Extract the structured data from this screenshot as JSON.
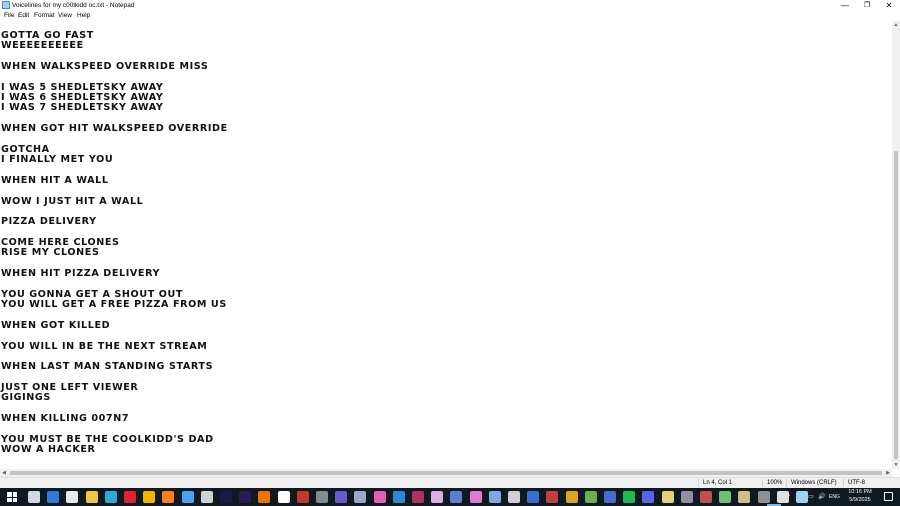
{
  "window": {
    "title": "Voicelines for my c00lkidd oc.txt - Notepad",
    "controls": {
      "minimize": "—",
      "maximize": "❐",
      "close": "✕"
    }
  },
  "menu": [
    "File",
    "Edit",
    "Format",
    "View",
    "Help"
  ],
  "document": {
    "lines": [
      "GOTTA GO FAST",
      "WEEEEEEEEEE",
      "",
      "WHEN WALKSPEED OVERRIDE MISS",
      "",
      "I WAS 5 SHEDLETSKY AWAY",
      "I WAS 6 SHEDLETSKY AWAY",
      "I WAS 7 SHEDLETSKY AWAY",
      "",
      "WHEN GOT HIT WALKSPEED OVERRIDE",
      "",
      "GOTCHA",
      "I FINALLY MET YOU",
      "",
      "WHEN HIT A WALL",
      "",
      "WOW I JUST HIT A WALL",
      "",
      "PIZZA DELIVERY",
      "",
      "COME HERE CLONES",
      "RISE MY CLONES",
      "",
      "WHEN HIT PIZZA DELIVERY",
      "",
      "YOU GONNA GET A SHOUT OUT",
      "YOU WILL GET A FREE PIZZA FROM US",
      "",
      "WHEN GOT KILLED",
      "",
      "YOU WILL IN BE THE NEXT STREAM",
      "",
      "WHEN LAST MAN STANDING STARTS",
      "",
      "JUST ONE LEFT VIEWER",
      "GIGINGS",
      "",
      "WHEN KILLING 007N7",
      "",
      "YOU MUST BE THE COOLKIDD'S DAD",
      "WOW A HACKER"
    ]
  },
  "scrollbars": {
    "up": "▲",
    "down": "▼",
    "left": "◀",
    "right": "▶"
  },
  "status": {
    "position": "Ln 4, Col 1",
    "zoom": "100%",
    "line_ending": "Windows (CRLF)",
    "encoding": "UTF-8"
  },
  "taskbar": {
    "apps": [
      {
        "name": "task-view",
        "color": "#cfd8e3"
      },
      {
        "name": "mail",
        "color": "#2f7bd6"
      },
      {
        "name": "store",
        "color": "#e8e8e8"
      },
      {
        "name": "file-explorer",
        "color": "#f2c744"
      },
      {
        "name": "edge",
        "color": "#2fa8d8"
      },
      {
        "name": "opera",
        "color": "#e0242f"
      },
      {
        "name": "chrome",
        "color": "#f4b400"
      },
      {
        "name": "firefox",
        "color": "#ff7d1f"
      },
      {
        "name": "calendar",
        "color": "#4aa3f0"
      },
      {
        "name": "notes",
        "color": "#d0d0d0"
      },
      {
        "name": "animate",
        "color": "#1a1a4a"
      },
      {
        "name": "premiere",
        "color": "#2a1a5a"
      },
      {
        "name": "blender",
        "color": "#ea7600"
      },
      {
        "name": "roblox-studio",
        "color": "#ffffff"
      },
      {
        "name": "game-1",
        "color": "#c0392b"
      },
      {
        "name": "game-2",
        "color": "#7f8c8d"
      },
      {
        "name": "game-3",
        "color": "#6a5acd"
      },
      {
        "name": "game-4",
        "color": "#9aa9c7"
      },
      {
        "name": "droplet-app",
        "color": "#e55fb0"
      },
      {
        "name": "vscode",
        "color": "#2a8ad4"
      },
      {
        "name": "game-5",
        "color": "#b03060"
      },
      {
        "name": "game-6",
        "color": "#d8b0e0"
      },
      {
        "name": "game-7",
        "color": "#5a7fd0"
      },
      {
        "name": "game-8",
        "color": "#e07bd0"
      },
      {
        "name": "game-9",
        "color": "#7fa9e0"
      },
      {
        "name": "media-player",
        "color": "#d0d0d0"
      },
      {
        "name": "game-10",
        "color": "#3a6fd0"
      },
      {
        "name": "game-11",
        "color": "#c04040"
      },
      {
        "name": "game-12",
        "color": "#e0a020"
      },
      {
        "name": "minecraft",
        "color": "#6ab04c"
      },
      {
        "name": "game-13",
        "color": "#4a6ad0"
      },
      {
        "name": "spotify",
        "color": "#1db954"
      },
      {
        "name": "discord",
        "color": "#5865f2"
      },
      {
        "name": "game-14",
        "color": "#e8d078"
      },
      {
        "name": "game-15",
        "color": "#9090a0"
      },
      {
        "name": "game-16",
        "color": "#c05050"
      },
      {
        "name": "game-17",
        "color": "#70c070"
      },
      {
        "name": "game-18",
        "color": "#d0c080"
      },
      {
        "name": "game-19",
        "color": "#909090"
      },
      {
        "name": "game-20",
        "color": "#e0e0e0"
      },
      {
        "name": "notepad",
        "color": "#9fd3f2"
      }
    ],
    "tray": [
      "^",
      "☁",
      "▭",
      "🔊",
      "ENG"
    ],
    "time": "10:16 PM",
    "date": "5/9/2025"
  }
}
